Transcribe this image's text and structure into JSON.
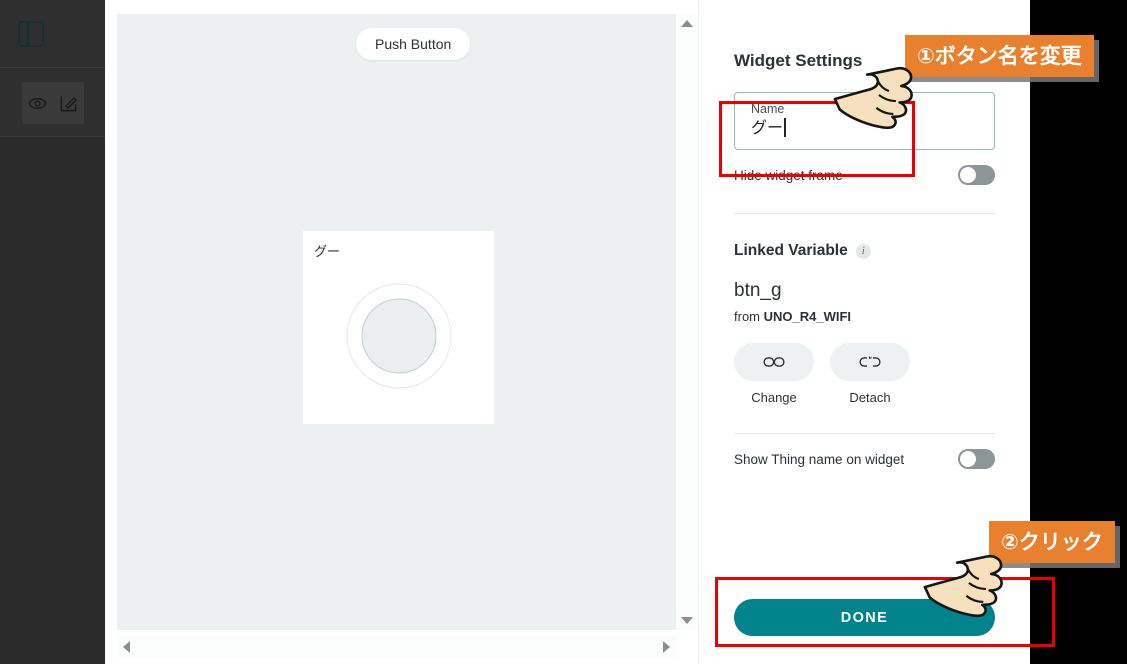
{
  "sidebar": {
    "panel_icon": "panel-layout-icon",
    "tools": [
      {
        "icon": "eye-icon",
        "name": "preview"
      },
      {
        "icon": "edit-pencil-icon",
        "name": "edit"
      }
    ]
  },
  "canvas": {
    "pill_label": "Push Button",
    "widget": {
      "label": "グー",
      "type": "push-button"
    }
  },
  "settings": {
    "title": "Widget Settings",
    "name_field": {
      "label": "Name",
      "value": "グー"
    },
    "hide_widget_frame": {
      "label": "Hide widget frame",
      "state": "off"
    },
    "linked_variable": {
      "title": "Linked Variable",
      "info_glyph": "i",
      "variable": "btn_g",
      "from_prefix": "from",
      "from_thing": "UNO_R4_WIFI",
      "actions": [
        {
          "icon": "link-icon",
          "label": "Change"
        },
        {
          "icon": "broken-link-icon",
          "label": "Detach"
        }
      ]
    },
    "show_thing_name": {
      "label": "Show Thing name on widget",
      "state": "off"
    },
    "done_label": "DONE"
  },
  "annotations": {
    "step1": "①ボタン名を変更",
    "step2": "②クリック"
  },
  "colors": {
    "accent_teal": "#00838a",
    "annotation_orange": "#e8802e",
    "highlight_red": "#ee0000",
    "canvas_bg": "#ecf0f1",
    "sidebar_bg": "#2f2f2f",
    "input_border": "#8fb9bd"
  }
}
